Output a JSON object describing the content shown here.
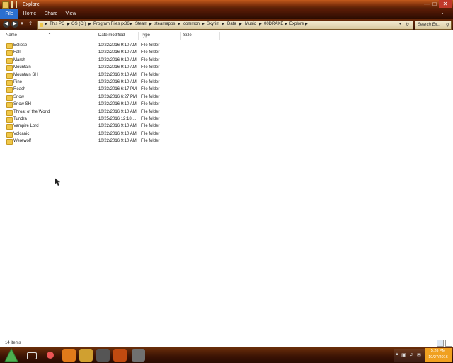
{
  "window": {
    "title": "Explore"
  },
  "ribbon": {
    "tabs": [
      "File",
      "Home",
      "Share",
      "View"
    ]
  },
  "breadcrumb": [
    "This PC",
    "OS (C:)",
    "Program Files (x86)",
    "Steam",
    "steamapps",
    "common",
    "Skyrim",
    "Data",
    "Music",
    "00DRAKE",
    "Explore"
  ],
  "search": {
    "placeholder": "Search Ex..."
  },
  "columns": [
    "Name",
    "Date modified",
    "Type",
    "Size"
  ],
  "rows": [
    {
      "name": "Eclipse",
      "date": "10/22/2016 9:10 AM",
      "type": "File folder"
    },
    {
      "name": "Fall",
      "date": "10/22/2016 9:10 AM",
      "type": "File folder"
    },
    {
      "name": "Marsh",
      "date": "10/22/2016 9:10 AM",
      "type": "File folder"
    },
    {
      "name": "Mountain",
      "date": "10/22/2016 9:10 AM",
      "type": "File folder"
    },
    {
      "name": "Mountain SH",
      "date": "10/22/2016 9:10 AM",
      "type": "File folder"
    },
    {
      "name": "Pine",
      "date": "10/22/2016 9:10 AM",
      "type": "File folder"
    },
    {
      "name": "Reach",
      "date": "10/23/2016 6:17 PM",
      "type": "File folder"
    },
    {
      "name": "Snow",
      "date": "10/23/2016 6:27 PM",
      "type": "File folder"
    },
    {
      "name": "Snow SH",
      "date": "10/22/2016 9:10 AM",
      "type": "File folder"
    },
    {
      "name": "Throat of the World",
      "date": "10/22/2016 9:10 AM",
      "type": "File folder"
    },
    {
      "name": "Tundra",
      "date": "10/25/2016 12:18 ...",
      "type": "File folder"
    },
    {
      "name": "Vampire Lord",
      "date": "10/22/2016 9:10 AM",
      "type": "File folder"
    },
    {
      "name": "Volcanic",
      "date": "10/22/2016 9:10 AM",
      "type": "File folder"
    },
    {
      "name": "Werewolf",
      "date": "10/22/2016 9:10 AM",
      "type": "File folder"
    }
  ],
  "status": {
    "items": "14 items"
  },
  "clock": {
    "time": "5:26 PM",
    "date": "10/27/2016"
  },
  "colors": {
    "accent": "#2a6fd0",
    "frame": "#7a2e0a",
    "folder": "#f0c84a",
    "clock": "#f0a020"
  }
}
